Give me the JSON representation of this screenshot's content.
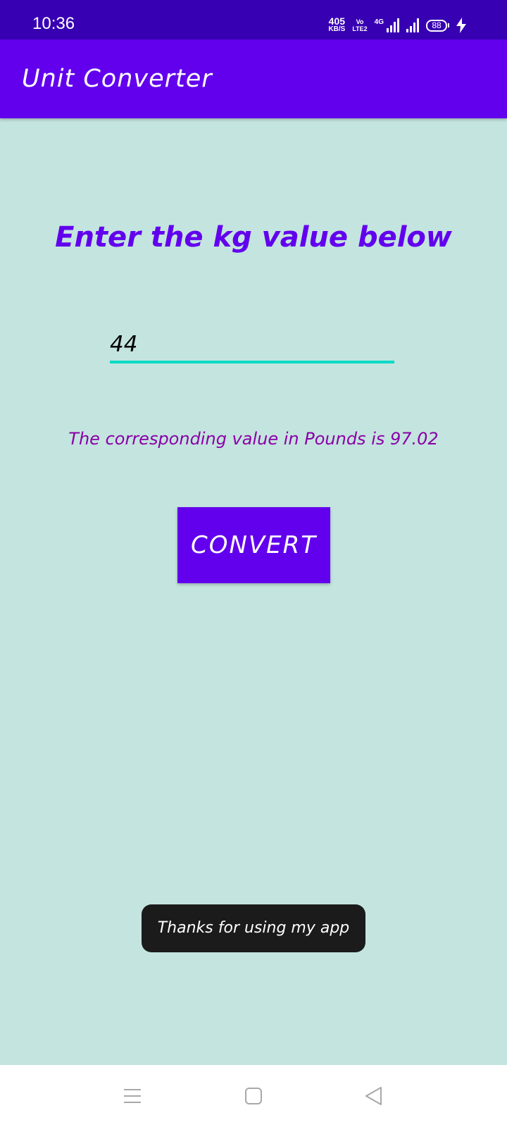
{
  "status_bar": {
    "time": "10:36",
    "net_speed_value": "405",
    "net_speed_unit": "KB/S",
    "volte_top": "Vo",
    "volte_bottom": "LTE2",
    "network_type": "4G",
    "battery": "88"
  },
  "app_bar": {
    "title": "Unit Converter"
  },
  "main": {
    "heading": "Enter the kg value below",
    "kg_input_value": "44",
    "result_text": "The corresponding value in Pounds is 97.02",
    "convert_label": "CONVERT"
  },
  "toast": {
    "message": "Thanks for using my app"
  },
  "nav_bar": {
    "icons": [
      "menu-icon",
      "home-square-icon",
      "back-triangle-icon"
    ]
  },
  "colors": {
    "status_bar": "#3700b3",
    "app_bar": "#6200ee",
    "background": "#c4e4df",
    "heading": "#6200ee",
    "result": "#8a00a8",
    "input_underline": "#03dac5",
    "toast_bg": "#1b1b1b"
  }
}
